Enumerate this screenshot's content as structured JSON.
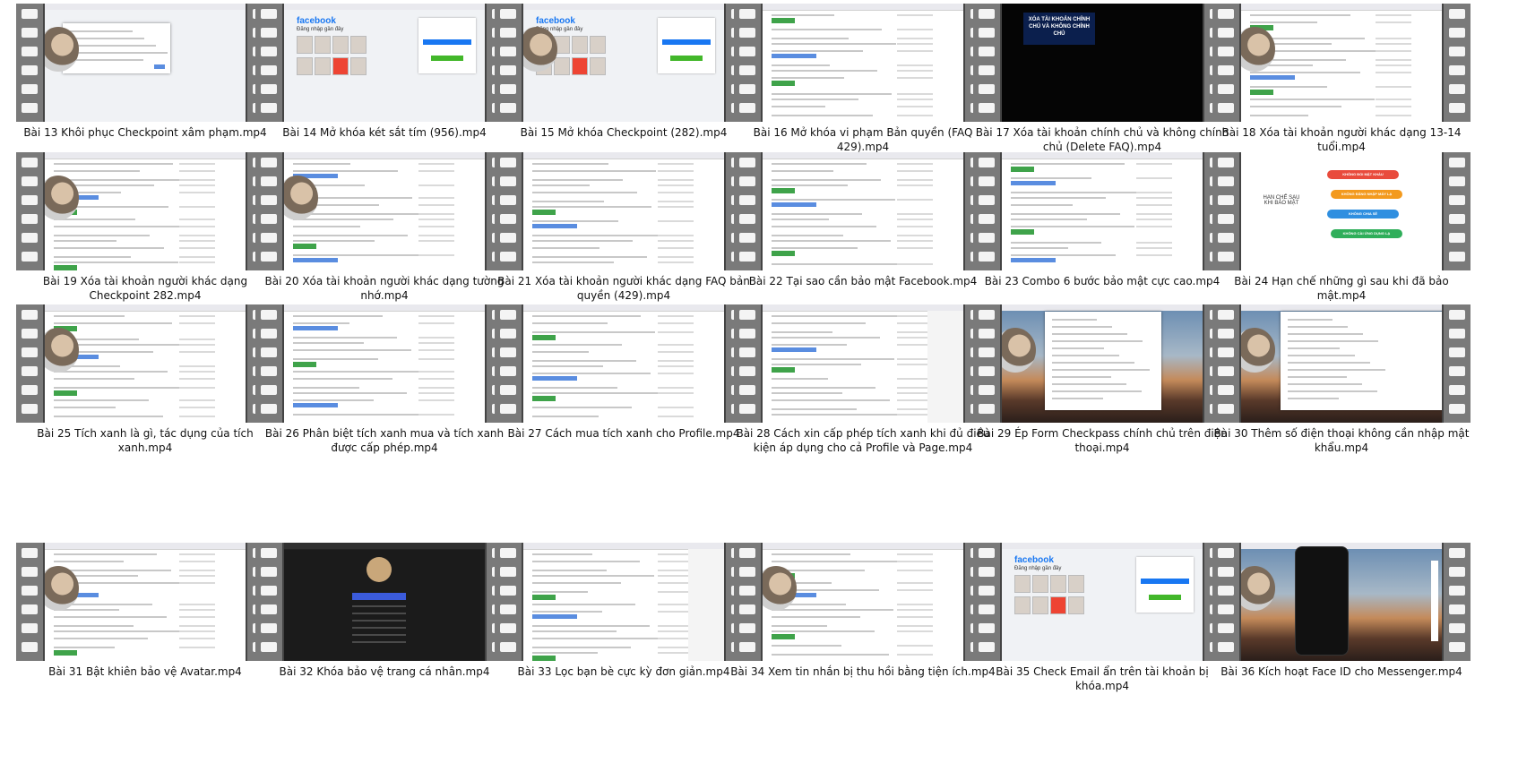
{
  "items": [
    {
      "label": "Bài 13 Khôi phục Checkpoint xâm phạm.mp4",
      "thumb": "checkpoint-form"
    },
    {
      "label": "Bài 14 Mở khóa két sắt tím (956).mp4",
      "thumb": "facebook-login"
    },
    {
      "label": "Bài 15 Mở khóa Checkpoint (282).mp4",
      "thumb": "facebook-login"
    },
    {
      "label": "Bài 16 Mở khóa vi phạm Bản quyền (FAQ 429).mp4",
      "thumb": "course-list"
    },
    {
      "label": "Bài 17 Xóa tài khoản chính chủ và không chính chủ (Delete FAQ).mp4",
      "thumb": "title-slide",
      "slide_text": "XÓA TÀI KHOẢN CHÍNH CHỦ VÀ KHÔNG CHÍNH CHỦ"
    },
    {
      "label": "Bài 18 Xóa tài khoản người khác dạng 13-14 tuổi.mp4",
      "thumb": "course-list"
    },
    {
      "label": "Bài 19 Xóa tài khoản người khác dạng Checkpoint 282.mp4",
      "thumb": "course-list"
    },
    {
      "label": "Bài 20 Xóa tài khoản người khác dạng tường nhớ.mp4",
      "thumb": "course-list"
    },
    {
      "label": "Bài 21 Xóa tài khoản người khác dạng FAQ bản quyền (429).mp4",
      "thumb": "course-list"
    },
    {
      "label": "Bài 22 Tại sao cần bảo mật Facebook.mp4",
      "thumb": "course-list"
    },
    {
      "label": "Bài 23 Combo 6 bước bảo mật cực cao.mp4",
      "thumb": "course-list"
    },
    {
      "label": "Bài 24 Hạn chế những gì sau khi đã bảo mật.mp4",
      "thumb": "mindmap",
      "mind_center": "HẠN CHẾ SAU KHI BẢO MẬT"
    },
    {
      "label": "Bài 25 Tích xanh là gì, tác dụng của tích xanh.mp4",
      "thumb": "course-list"
    },
    {
      "label": "Bài 26 Phân biệt tích xanh mua và tích xanh được cấp phép.mp4",
      "thumb": "course-list"
    },
    {
      "label": "Bài 27 Cách mua tích xanh cho Profile.mp4",
      "thumb": "course-list"
    },
    {
      "label": "Bài 28 Cách xin cấp phép tích xanh khi đủ điều kiện áp dụng cho cả Profile và Page.mp4",
      "thumb": "course-list"
    },
    {
      "label": "Bài 29 Ép Form Checkpass chính chủ trên điện thoại.mp4",
      "thumb": "desktop-browser"
    },
    {
      "label": "Bài 30 Thêm số điện thoại không cần nhập mật khẩu.mp4",
      "thumb": "desktop-browser"
    },
    {
      "label": "Bài 31 Bật khiên bảo vệ Avatar.mp4",
      "thumb": "course-list"
    },
    {
      "label": "Bài 32 Khóa bảo vệ trang cá nhân.mp4",
      "thumb": "dark-profile"
    },
    {
      "label": "Bài 33 Lọc bạn bè cực kỳ đơn giản.mp4",
      "thumb": "course-list"
    },
    {
      "label": "Bài 34 Xem tin nhắn bị thu hồi bằng tiện ích.mp4",
      "thumb": "course-list"
    },
    {
      "label": "Bài 35 Check Email ẩn trên tài khoản bị khóa.mp4",
      "thumb": "facebook-login"
    },
    {
      "label": "Bài 36 Kích hoạt Face ID cho Messenger.mp4",
      "thumb": "phone-desktop"
    }
  ],
  "facebook": {
    "logo": "facebook",
    "sub": "Đăng nhập gần đây"
  },
  "mind_pills": [
    {
      "text": "KHÔNG ĐỔI MẬT KHẨU",
      "color": "#e94b3c"
    },
    {
      "text": "KHÔNG ĐĂNG NHẬP MÁY LẠ",
      "color": "#f39a1e"
    },
    {
      "text": "KHÔNG CHIA SẺ",
      "color": "#2f8fe0"
    },
    {
      "text": "KHÔNG CÀI ỨNG DỤNG LẠ",
      "color": "#2fae5a"
    }
  ]
}
